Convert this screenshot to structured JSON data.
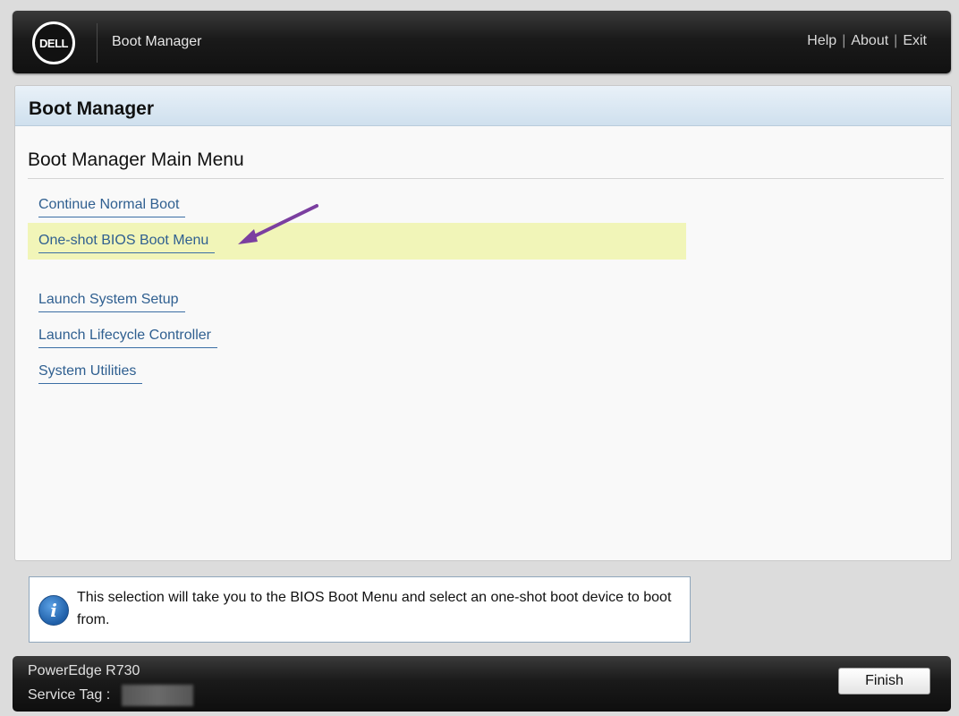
{
  "header": {
    "logo_text": "DELL",
    "title": "Boot Manager",
    "links": [
      "Help",
      "About",
      "Exit"
    ],
    "separator": "|"
  },
  "panel": {
    "title": "Boot Manager",
    "section_title": "Boot Manager Main Menu",
    "menu_items": [
      {
        "label": "Continue Normal Boot"
      },
      {
        "label": "One-shot BIOS Boot Menu",
        "selected": true
      },
      {
        "label": "Launch System Setup"
      },
      {
        "label": "Launch Lifecycle Controller"
      },
      {
        "label": "System Utilities"
      }
    ]
  },
  "info": {
    "icon": "info-icon",
    "text": "This selection will take you to the BIOS Boot Menu and select an one-shot boot device to boot from."
  },
  "footer": {
    "model": "PowerEdge R730",
    "service_tag_label": "Service Tag :",
    "finish_label": "Finish"
  },
  "colors": {
    "highlight": "#f1f5b8",
    "link": "#2f5f90",
    "arrow": "#7b3fa0"
  }
}
